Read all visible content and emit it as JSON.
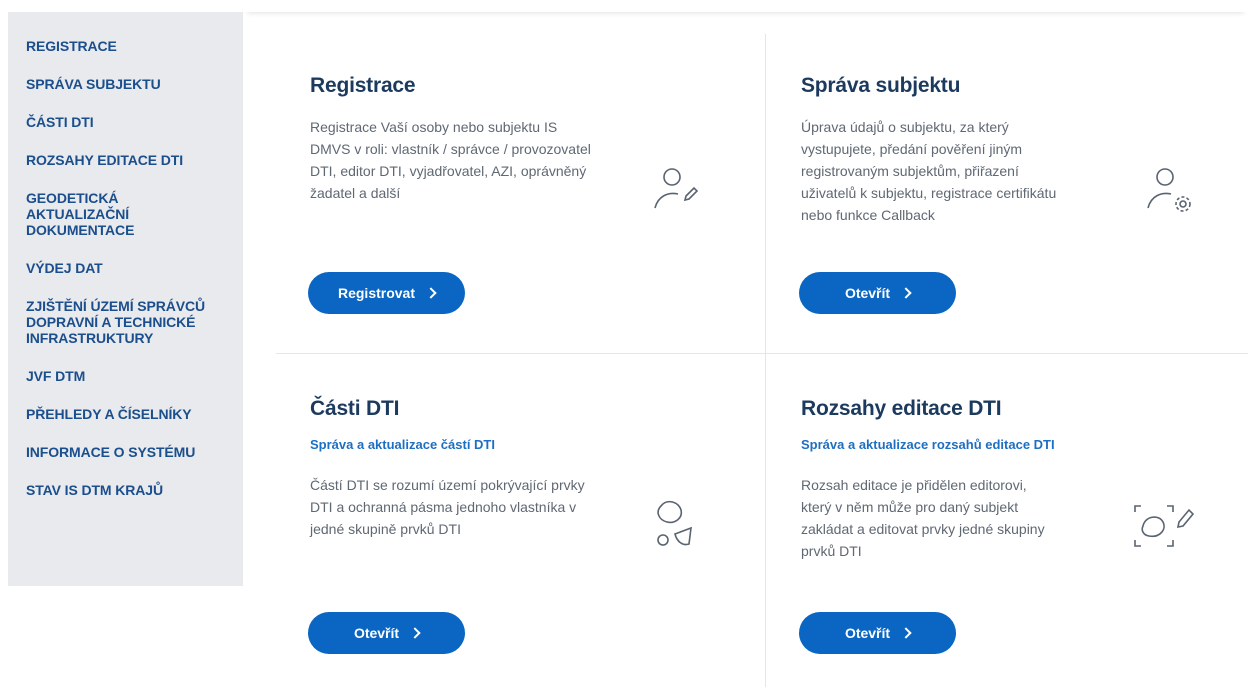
{
  "sidebar": {
    "items": [
      {
        "label": "REGISTRACE"
      },
      {
        "label": "SPRÁVA SUBJEKTU"
      },
      {
        "label": "ČÁSTI DTI"
      },
      {
        "label": "ROZSAHY EDITACE DTI"
      },
      {
        "label": "GEODETICKÁ AKTUALIZAČNÍ DOKUMENTACE"
      },
      {
        "label": "VÝDEJ DAT"
      },
      {
        "label": "ZJIŠTĚNÍ ÚZEMÍ SPRÁVCŮ DOPRAVNÍ A TECHNICKÉ INFRASTRUKTURY"
      },
      {
        "label": "JVF DTM"
      },
      {
        "label": "PŘEHLEDY A ČÍSELNÍKY"
      },
      {
        "label": "INFORMACE O SYSTÉMU"
      },
      {
        "label": "STAV IS DTM KRAJŮ"
      }
    ]
  },
  "cards": {
    "registrace": {
      "title": "Registrace",
      "description": "Registrace Vaší osoby nebo subjektu IS DMVS v roli: vlastník / správce / provozovatel DTI, editor DTI, vyjadřovatel, AZI, oprávněný žadatel a další",
      "button": "Registrovat",
      "icon": "user-edit-icon"
    },
    "sprava": {
      "title": "Správa subjektu",
      "description": "Úprava údajů o subjektu, za který vystupujete, předání pověření jiným registrovaným subjektům, přiřazení uživatelů k subjektu, registrace certifikátu nebo funkce Callback",
      "button": "Otevřít",
      "icon": "user-settings-icon"
    },
    "casti": {
      "title": "Části DTI",
      "subtitle": "Správa a aktualizace částí DTI",
      "description": "Částí DTI se rozumí území pokrývající prvky DTI a ochranná pásma jednoho vlastníka v jedné skupině prvků DTI",
      "button": "Otevřít",
      "icon": "areas-icon"
    },
    "rozsahy": {
      "title": "Rozsahy editace DTI",
      "subtitle": "Správa a aktualizace rozsahů editace DTI",
      "description": "Rozsah editace je přidělen editorovi, který v něm může pro daný subjekt zakládat a editovat prvky jedné skupiny prvků DTI",
      "button": "Otevřít",
      "icon": "area-edit-icon"
    }
  },
  "colors": {
    "accent": "#0a66c2",
    "nav_text": "#1b4e8c",
    "sidebar_bg": "#e8eaed",
    "title": "#1c3a5e"
  }
}
